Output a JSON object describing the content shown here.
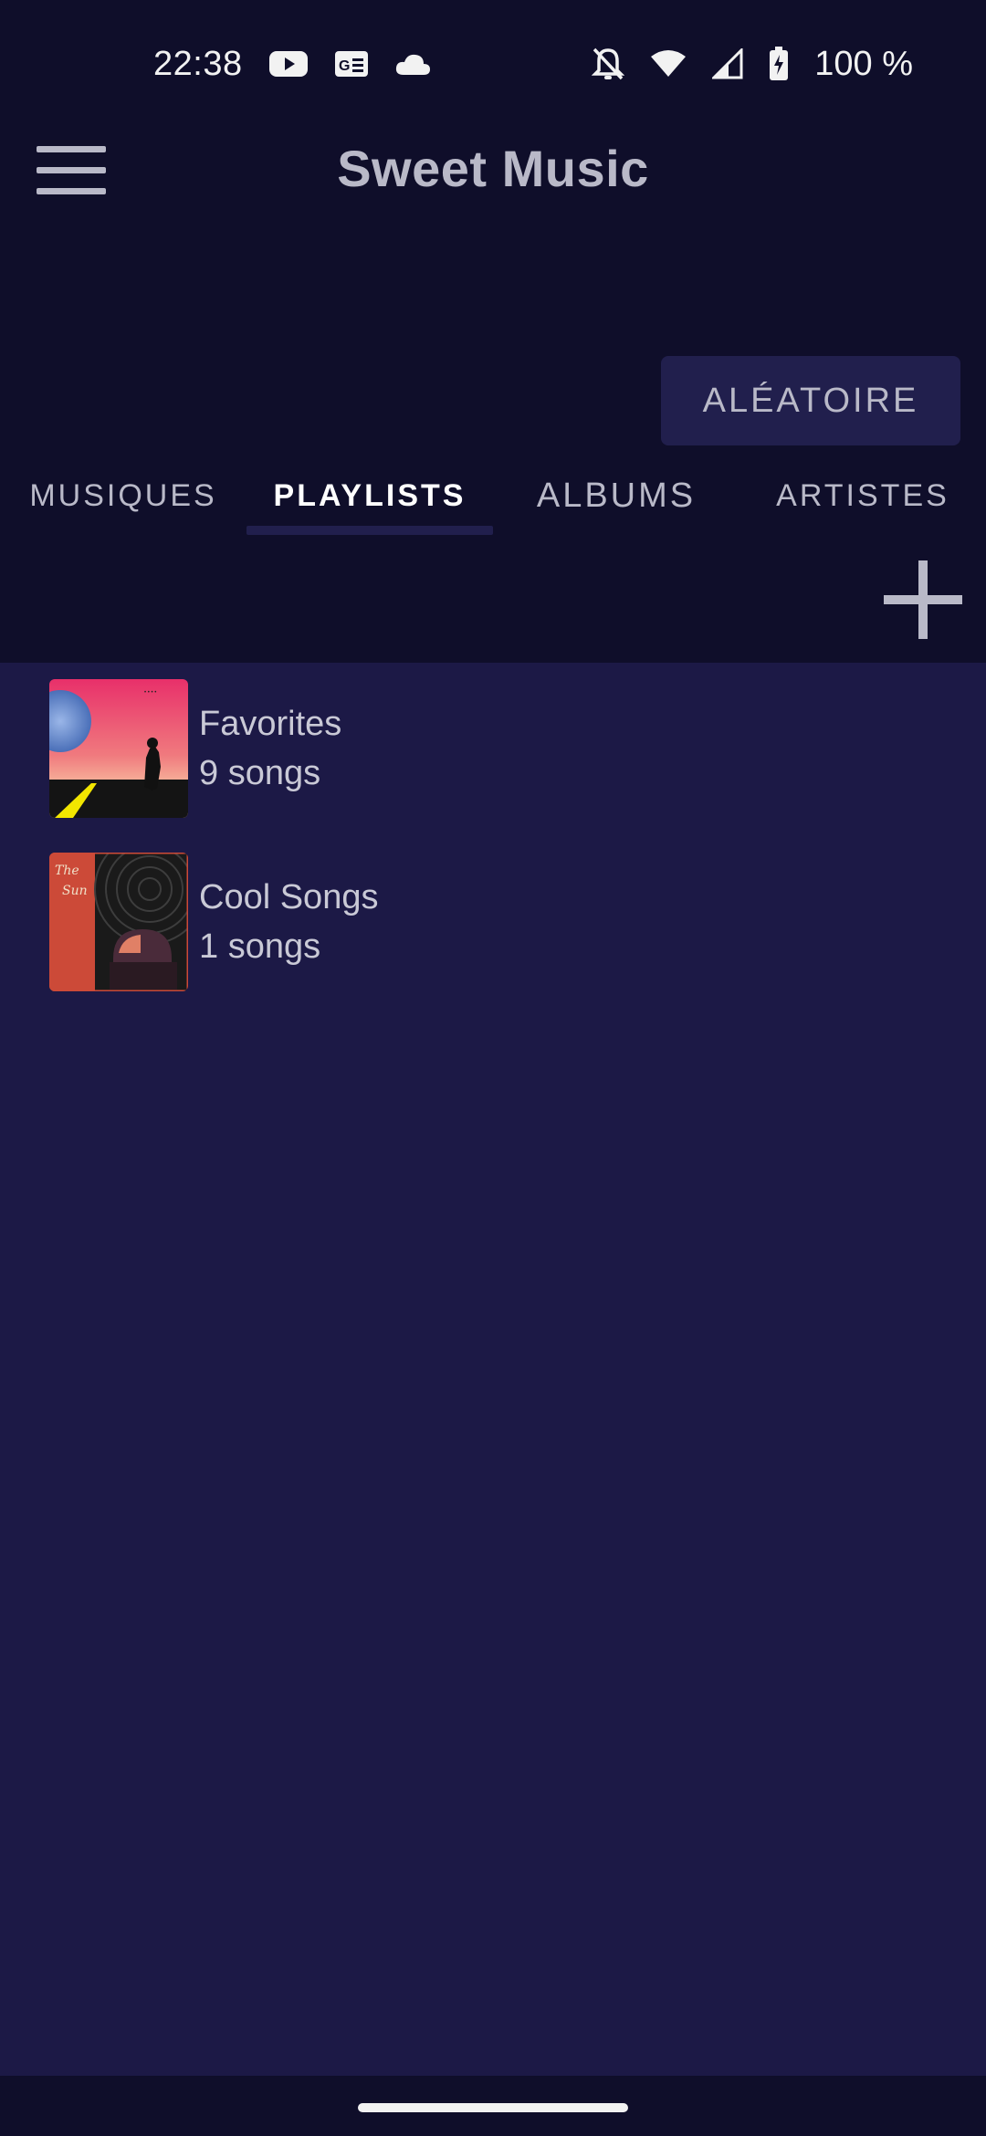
{
  "status_bar": {
    "time": "22:38",
    "battery_text": "100 %",
    "icons_left": [
      "youtube-icon",
      "news-icon",
      "cloud-icon"
    ],
    "icons_right": [
      "bell-off-icon",
      "wifi-icon",
      "signal-icon",
      "battery-charging-icon"
    ]
  },
  "app_bar": {
    "title": "Sweet Music",
    "menu_icon": "hamburger-menu-icon"
  },
  "shuffle": {
    "label": "ALÉATOIRE"
  },
  "tabs": [
    {
      "label": "MUSIQUES",
      "active": false
    },
    {
      "label": "PLAYLISTS",
      "active": true
    },
    {
      "label": "ALBUMS",
      "active": false
    },
    {
      "label": "ARTISTES",
      "active": false
    }
  ],
  "actions": {
    "add_icon": "plus-icon"
  },
  "playlists": [
    {
      "name": "Favorites",
      "count": "9 songs"
    },
    {
      "name": "Cool Songs",
      "count": "1 songs"
    }
  ],
  "colors": {
    "background": "#0f0e2a",
    "content_background": "#1c1946",
    "button_background": "#211f4d",
    "text": "#b9b9c8",
    "active_tab_text": "#ffffff"
  }
}
